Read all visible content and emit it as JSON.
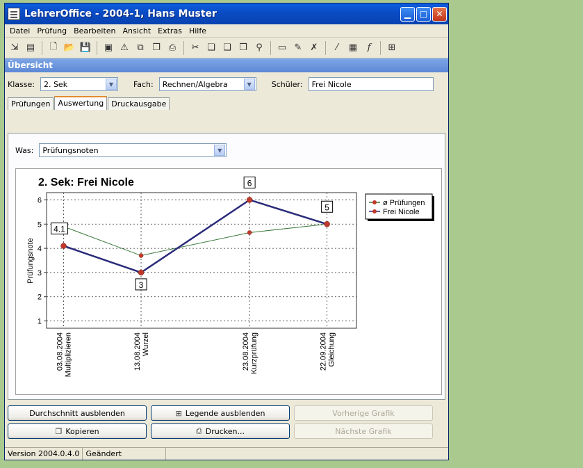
{
  "window": {
    "title": "LehrerOffice - 2004-1, Hans Muster"
  },
  "menu": [
    "Datei",
    "Prüfung",
    "Bearbeiten",
    "Ansicht",
    "Extras",
    "Hilfe"
  ],
  "toolbar_icons": [
    "import-icon",
    "export-icon",
    "new-icon",
    "open-icon",
    "save-icon",
    "properties-icon",
    "wizard-icon",
    "copy-class-icon",
    "copy-icon",
    "print-icon",
    "cut-icon",
    "copy2-icon",
    "paste-icon",
    "paste-special-icon",
    "find-icon",
    "folder-icon",
    "edit-icon",
    "delete-icon",
    "pen-icon",
    "calculator-icon",
    "formula-icon",
    "legend-icon"
  ],
  "section": {
    "title": "Übersicht"
  },
  "filters": {
    "klasse_label": "Klasse:",
    "klasse_value": "2. Sek",
    "fach_label": "Fach:",
    "fach_value": "Rechnen/Algebra",
    "schueler_label": "Schüler:",
    "schueler_value": "Frei Nicole"
  },
  "tabs": [
    "Prüfungen",
    "Auswertung",
    "Druckausgabe"
  ],
  "active_tab": "Auswertung",
  "was": {
    "label": "Was:",
    "value": "Prüfungsnoten"
  },
  "chart_data": {
    "type": "line",
    "title": "2. Sek:  Frei Nicole",
    "ylabel": "Prüfungsnote",
    "xlabel": "",
    "ylim": [
      0.7,
      6.3
    ],
    "yticks": [
      1,
      2,
      3,
      4,
      5,
      6
    ],
    "grid": true,
    "legend_position": "top-right",
    "categories": [
      [
        "03.08.2004",
        "Multiplizieren"
      ],
      [
        "13.08.2004",
        "Wurzel"
      ],
      [
        "23.08.2004",
        "Kurzprüfung"
      ],
      [
        "22.09.2004",
        "Gleichung"
      ]
    ],
    "x_positions": [
      0,
      1,
      2.4,
      3.4
    ],
    "series": [
      {
        "name": "ø Prüfungen",
        "values": [
          4.9,
          3.7,
          4.65,
          5.0
        ],
        "color": "#3a7a3a"
      },
      {
        "name": "Frei Nicole",
        "values": [
          4.1,
          3.0,
          6.0,
          5.0
        ],
        "color": "#2a2a7a",
        "labels": [
          "4.1",
          "3",
          "6",
          "5"
        ]
      }
    ],
    "marker_color": "#c0392b"
  },
  "buttons": {
    "durchschnitt": "Durchschnitt ausblenden",
    "legende": "Legende ausblenden",
    "vorherige": "Vorherige Grafik",
    "kopieren": "Kopieren",
    "drucken": "Drucken...",
    "naechste": "Nächste Grafik"
  },
  "status": {
    "version": "Version 2004.0.4.0",
    "state": "Geändert"
  }
}
